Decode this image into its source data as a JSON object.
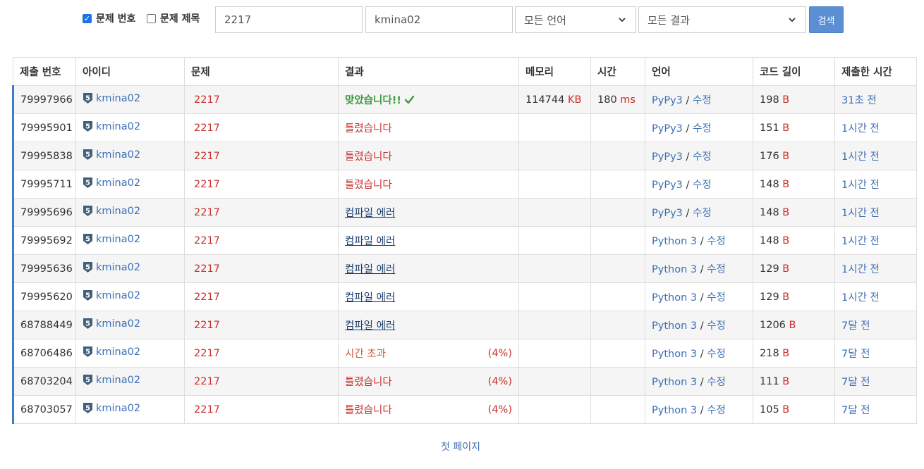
{
  "search": {
    "chk_problem_id": {
      "label": "문제 번호",
      "checked": true
    },
    "chk_problem_title": {
      "label": "문제 제목",
      "checked": false
    },
    "problem_input": "2217",
    "user_input": "kmina02",
    "language_select": "모든 언어",
    "result_select": "모든 결과",
    "search_button": "검색"
  },
  "table": {
    "headers": [
      "제출 번호",
      "아이디",
      "문제",
      "결과",
      "메모리",
      "시간",
      "언어",
      "코드 길이",
      "제출한 시간"
    ],
    "edit_label": "수정",
    "rows": [
      {
        "id": "79997966",
        "user": "kmina02",
        "problem": "2217",
        "result": "맞았습니다!!",
        "result_type": "ok",
        "pct": "",
        "memory": "114744",
        "memory_unit": "KB",
        "time": "180",
        "time_unit": "ms",
        "lang": "PyPy3",
        "code_len": "198",
        "code_unit": "B",
        "submitted": "31초 전"
      },
      {
        "id": "79995901",
        "user": "kmina02",
        "problem": "2217",
        "result": "틀렸습니다",
        "result_type": "wa",
        "pct": "",
        "memory": "",
        "memory_unit": "",
        "time": "",
        "time_unit": "",
        "lang": "PyPy3",
        "code_len": "151",
        "code_unit": "B",
        "submitted": "1시간 전"
      },
      {
        "id": "79995838",
        "user": "kmina02",
        "problem": "2217",
        "result": "틀렸습니다",
        "result_type": "wa",
        "pct": "",
        "memory": "",
        "memory_unit": "",
        "time": "",
        "time_unit": "",
        "lang": "PyPy3",
        "code_len": "176",
        "code_unit": "B",
        "submitted": "1시간 전"
      },
      {
        "id": "79995711",
        "user": "kmina02",
        "problem": "2217",
        "result": "틀렸습니다",
        "result_type": "wa",
        "pct": "",
        "memory": "",
        "memory_unit": "",
        "time": "",
        "time_unit": "",
        "lang": "PyPy3",
        "code_len": "148",
        "code_unit": "B",
        "submitted": "1시간 전"
      },
      {
        "id": "79995696",
        "user": "kmina02",
        "problem": "2217",
        "result": "컴파일 에러",
        "result_type": "ce",
        "pct": "",
        "memory": "",
        "memory_unit": "",
        "time": "",
        "time_unit": "",
        "lang": "PyPy3",
        "code_len": "148",
        "code_unit": "B",
        "submitted": "1시간 전"
      },
      {
        "id": "79995692",
        "user": "kmina02",
        "problem": "2217",
        "result": "컴파일 에러",
        "result_type": "ce",
        "pct": "",
        "memory": "",
        "memory_unit": "",
        "time": "",
        "time_unit": "",
        "lang": "Python 3",
        "code_len": "148",
        "code_unit": "B",
        "submitted": "1시간 전"
      },
      {
        "id": "79995636",
        "user": "kmina02",
        "problem": "2217",
        "result": "컴파일 에러",
        "result_type": "ce",
        "pct": "",
        "memory": "",
        "memory_unit": "",
        "time": "",
        "time_unit": "",
        "lang": "Python 3",
        "code_len": "129",
        "code_unit": "B",
        "submitted": "1시간 전"
      },
      {
        "id": "79995620",
        "user": "kmina02",
        "problem": "2217",
        "result": "컴파일 에러",
        "result_type": "ce",
        "pct": "",
        "memory": "",
        "memory_unit": "",
        "time": "",
        "time_unit": "",
        "lang": "Python 3",
        "code_len": "129",
        "code_unit": "B",
        "submitted": "1시간 전"
      },
      {
        "id": "68788449",
        "user": "kmina02",
        "problem": "2217",
        "result": "컴파일 에러",
        "result_type": "ce",
        "pct": "",
        "memory": "",
        "memory_unit": "",
        "time": "",
        "time_unit": "",
        "lang": "Python 3",
        "code_len": "1206",
        "code_unit": "B",
        "submitted": "7달 전"
      },
      {
        "id": "68706486",
        "user": "kmina02",
        "problem": "2217",
        "result": "시간 초과",
        "result_type": "tle",
        "pct": "(4%)",
        "memory": "",
        "memory_unit": "",
        "time": "",
        "time_unit": "",
        "lang": "Python 3",
        "code_len": "218",
        "code_unit": "B",
        "submitted": "7달 전"
      },
      {
        "id": "68703204",
        "user": "kmina02",
        "problem": "2217",
        "result": "틀렸습니다",
        "result_type": "wa",
        "pct": "(4%)",
        "memory": "",
        "memory_unit": "",
        "time": "",
        "time_unit": "",
        "lang": "Python 3",
        "code_len": "111",
        "code_unit": "B",
        "submitted": "7달 전"
      },
      {
        "id": "68703057",
        "user": "kmina02",
        "problem": "2217",
        "result": "틀렸습니다",
        "result_type": "wa",
        "pct": "(4%)",
        "memory": "",
        "memory_unit": "",
        "time": "",
        "time_unit": "",
        "lang": "Python 3",
        "code_len": "105",
        "code_unit": "B",
        "submitted": "7달 전"
      }
    ]
  },
  "pagination": {
    "first_page": "첫 페이지"
  },
  "colors": {
    "link_blue": "#3d6fb6",
    "error_red": "#c9302c",
    "accepted_green": "#3c9a3c",
    "row_accent": "#3a7dc9",
    "button_blue": "#5a8fd4"
  },
  "icons": {
    "user_tier": "tier-shield-icon",
    "accepted": "checkmark-icon",
    "select_arrow": "chevron-down-icon"
  }
}
